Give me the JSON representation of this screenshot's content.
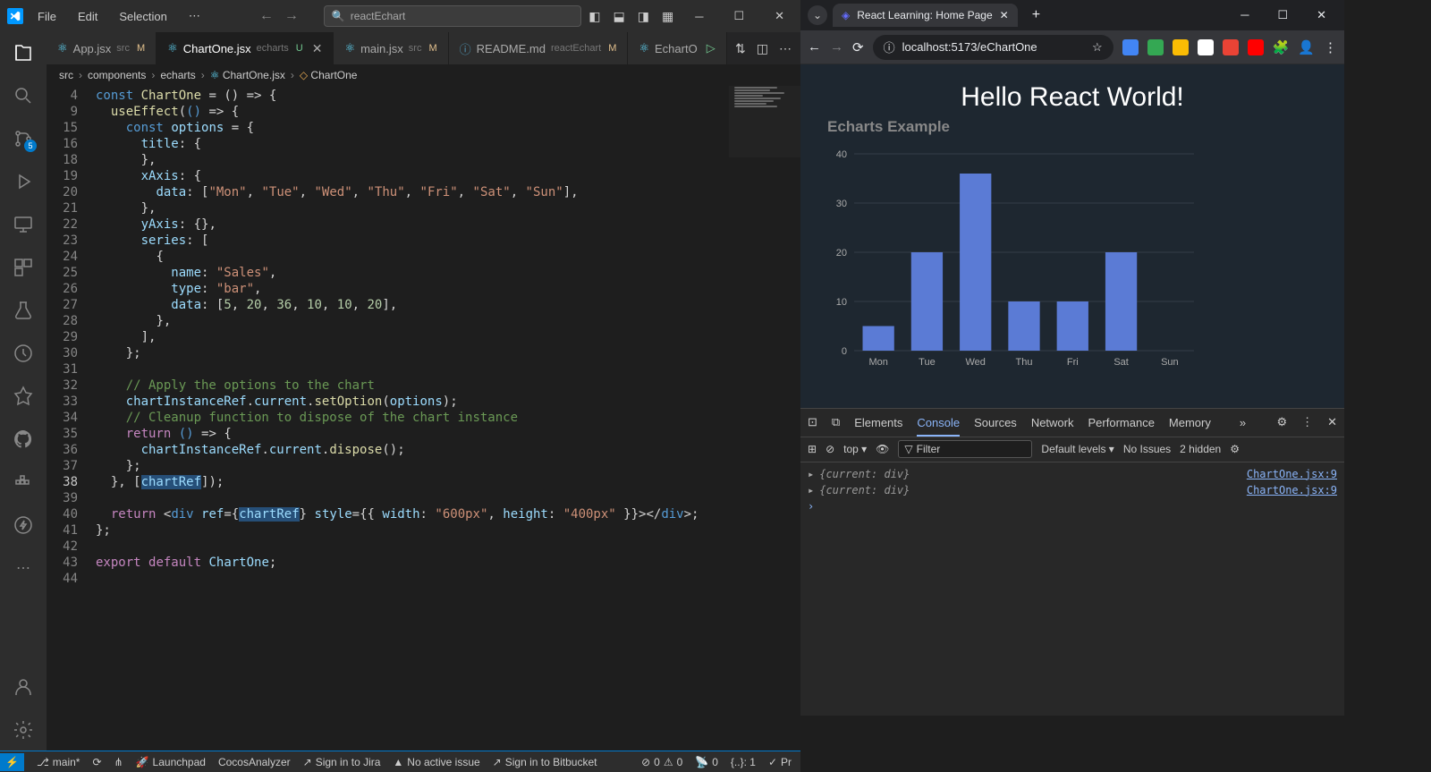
{
  "vscode": {
    "menu": [
      "File",
      "Edit",
      "Selection"
    ],
    "search_placeholder": "reactEchart",
    "scm_badge": "5",
    "tabs": [
      {
        "icon": "react",
        "name": "App.jsx",
        "meta": "src",
        "status": "M",
        "active": false
      },
      {
        "icon": "react",
        "name": "ChartOne.jsx",
        "meta": "echarts",
        "status": "U",
        "active": true,
        "close": true
      },
      {
        "icon": "react",
        "name": "main.jsx",
        "meta": "src",
        "status": "M",
        "active": false
      },
      {
        "icon": "info",
        "name": "README.md",
        "meta": "reactEchart",
        "status": "M",
        "active": false
      },
      {
        "icon": "react",
        "name": "EchartO",
        "meta": "",
        "status": "",
        "active": false,
        "play": true
      }
    ],
    "breadcrumb": [
      "src",
      "components",
      "echarts",
      "ChartOne.jsx",
      "ChartOne"
    ],
    "code": [
      {
        "n": 4,
        "html": "<span class='tok-kw'>const</span> <span class='tok-fn'>ChartOne</span> <span class='tok-punc'>= () =&gt; {</span>"
      },
      {
        "n": 9,
        "indent": 1,
        "html": "<span class='tok-fn'>useEffect</span><span class='tok-punc'>(</span><span class='tok-kw'>()</span> <span class='tok-punc'>=&gt; {</span>"
      },
      {
        "n": 15,
        "indent": 2,
        "html": "<span class='tok-kw'>const</span> <span class='tok-var'>options</span> <span class='tok-punc'>= {</span>"
      },
      {
        "n": 16,
        "indent": 3,
        "html": "<span class='tok-var'>title</span><span class='tok-punc'>: {</span>"
      },
      {
        "n": 18,
        "indent": 3,
        "html": "<span class='tok-punc'>},</span>"
      },
      {
        "n": 19,
        "indent": 3,
        "html": "<span class='tok-var'>xAxis</span><span class='tok-punc'>: {</span>"
      },
      {
        "n": 20,
        "indent": 4,
        "html": "<span class='tok-var'>data</span><span class='tok-punc'>: [</span><span class='tok-str'>\"Mon\"</span><span class='tok-punc'>, </span><span class='tok-str'>\"Tue\"</span><span class='tok-punc'>, </span><span class='tok-str'>\"Wed\"</span><span class='tok-punc'>, </span><span class='tok-str'>\"Thu\"</span><span class='tok-punc'>, </span><span class='tok-str'>\"Fri\"</span><span class='tok-punc'>, </span><span class='tok-str'>\"Sat\"</span><span class='tok-punc'>, </span><span class='tok-str'>\"Sun\"</span><span class='tok-punc'>],</span>"
      },
      {
        "n": 21,
        "indent": 3,
        "html": "<span class='tok-punc'>},</span>"
      },
      {
        "n": 22,
        "indent": 3,
        "html": "<span class='tok-var'>yAxis</span><span class='tok-punc'>: {},</span>"
      },
      {
        "n": 23,
        "indent": 3,
        "html": "<span class='tok-var'>series</span><span class='tok-punc'>: [</span>"
      },
      {
        "n": 24,
        "indent": 4,
        "html": "<span class='tok-punc'>{</span>"
      },
      {
        "n": 25,
        "indent": 5,
        "html": "<span class='tok-var'>name</span><span class='tok-punc'>: </span><span class='tok-str'>\"Sales\"</span><span class='tok-punc'>,</span>"
      },
      {
        "n": 26,
        "indent": 5,
        "html": "<span class='tok-var'>type</span><span class='tok-punc'>: </span><span class='tok-str'>\"bar\"</span><span class='tok-punc'>,</span>"
      },
      {
        "n": 27,
        "indent": 5,
        "html": "<span class='tok-var'>data</span><span class='tok-punc'>: [</span><span class='tok-num'>5</span><span class='tok-punc'>, </span><span class='tok-num'>20</span><span class='tok-punc'>, </span><span class='tok-num'>36</span><span class='tok-punc'>, </span><span class='tok-num'>10</span><span class='tok-punc'>, </span><span class='tok-num'>10</span><span class='tok-punc'>, </span><span class='tok-num'>20</span><span class='tok-punc'>],</span>"
      },
      {
        "n": 28,
        "indent": 4,
        "html": "<span class='tok-punc'>},</span>"
      },
      {
        "n": 29,
        "indent": 3,
        "html": "<span class='tok-punc'>],</span>"
      },
      {
        "n": 30,
        "indent": 2,
        "html": "<span class='tok-punc'>};</span>"
      },
      {
        "n": 31,
        "indent": 0,
        "html": ""
      },
      {
        "n": 32,
        "indent": 2,
        "html": "<span class='tok-comment'>// Apply the options to the chart</span>"
      },
      {
        "n": 33,
        "indent": 2,
        "html": "<span class='tok-var'>chartInstanceRef</span><span class='tok-punc'>.</span><span class='tok-var'>current</span><span class='tok-punc'>.</span><span class='tok-fn'>setOption</span><span class='tok-punc'>(</span><span class='tok-var'>options</span><span class='tok-punc'>);</span>"
      },
      {
        "n": 34,
        "indent": 2,
        "html": "<span class='tok-comment'>// Cleanup function to dispose of the chart instance</span>"
      },
      {
        "n": 35,
        "indent": 2,
        "html": "<span class='tok-kw2'>return</span> <span class='tok-kw'>()</span> <span class='tok-punc'>=&gt; {</span>"
      },
      {
        "n": 36,
        "indent": 3,
        "html": "<span class='tok-var'>chartInstanceRef</span><span class='tok-punc'>.</span><span class='tok-var'>current</span><span class='tok-punc'>.</span><span class='tok-fn'>dispose</span><span class='tok-punc'>();</span>"
      },
      {
        "n": 37,
        "indent": 2,
        "html": "<span class='tok-punc'>};</span>"
      },
      {
        "n": 38,
        "indent": 1,
        "current": true,
        "html": "<span class='tok-punc'>}, [</span><span class='tok-var tok-hl'>chartRef</span><span class='tok-punc'>]);</span>"
      },
      {
        "n": 39,
        "indent": 0,
        "html": ""
      },
      {
        "n": 40,
        "indent": 1,
        "html": "<span class='tok-kw2'>return</span> <span class='tok-punc'>&lt;</span><span class='tok-tag'>div</span> <span class='tok-attr'>ref</span><span class='tok-punc'>={</span><span class='tok-var tok-hl'>chartRef</span><span class='tok-punc'>}</span> <span class='tok-attr'>style</span><span class='tok-punc'>={{ </span><span class='tok-var'>width</span><span class='tok-punc'>: </span><span class='tok-str'>\"600px\"</span><span class='tok-punc'>, </span><span class='tok-var'>height</span><span class='tok-punc'>: </span><span class='tok-str'>\"400px\"</span><span class='tok-punc'> }}&gt;&lt;/</span><span class='tok-tag'>div</span><span class='tok-punc'>&gt;;</span>"
      },
      {
        "n": 41,
        "indent": 0,
        "html": "<span class='tok-punc'>};</span>"
      },
      {
        "n": 42,
        "indent": 0,
        "html": ""
      },
      {
        "n": 43,
        "indent": 0,
        "html": "<span class='tok-kw2'>export</span> <span class='tok-kw2'>default</span> <span class='tok-var'>ChartOne</span><span class='tok-punc'>;</span>"
      },
      {
        "n": 44,
        "indent": 0,
        "html": ""
      }
    ],
    "statusbar": {
      "branch": "main*",
      "launchpad": "Launchpad",
      "cocos": "CocosAnalyzer",
      "jira": "Sign in to Jira",
      "issue": "No active issue",
      "bitbucket": "Sign in to Bitbucket",
      "errors": "0",
      "warnings": "0",
      "ports": "0",
      "pos": "{..}: 1",
      "prettier": "Pr"
    }
  },
  "browser": {
    "tab_title": "React Learning: Home Page",
    "url": "localhost:5173/eChartOne",
    "page_heading": "Hello React World!",
    "chart_title": "Echarts Example",
    "devtools": {
      "tabs": [
        "Elements",
        "Console",
        "Sources",
        "Network",
        "Performance",
        "Memory"
      ],
      "active_tab": "Console",
      "context": "top",
      "filter_placeholder": "Filter",
      "levels": "Default levels",
      "issues": "No Issues",
      "hidden": "2 hidden",
      "logs": [
        {
          "obj": "{current: div}",
          "src": "ChartOne.jsx:9"
        },
        {
          "obj": "{current: div}",
          "src": "ChartOne.jsx:9"
        }
      ]
    }
  },
  "chart_data": {
    "type": "bar",
    "title": "Echarts Example",
    "categories": [
      "Mon",
      "Tue",
      "Wed",
      "Thu",
      "Fri",
      "Sat",
      "Sun"
    ],
    "series": [
      {
        "name": "Sales",
        "values": [
          5,
          20,
          36,
          10,
          10,
          20,
          null
        ]
      }
    ],
    "xlabel": "",
    "ylabel": "",
    "ylim": [
      0,
      40
    ],
    "yticks": [
      0,
      10,
      20,
      30,
      40
    ]
  },
  "colors": {
    "bar": "#5B7BD5",
    "grid": "#4a5560",
    "axis_text": "#aaa"
  }
}
